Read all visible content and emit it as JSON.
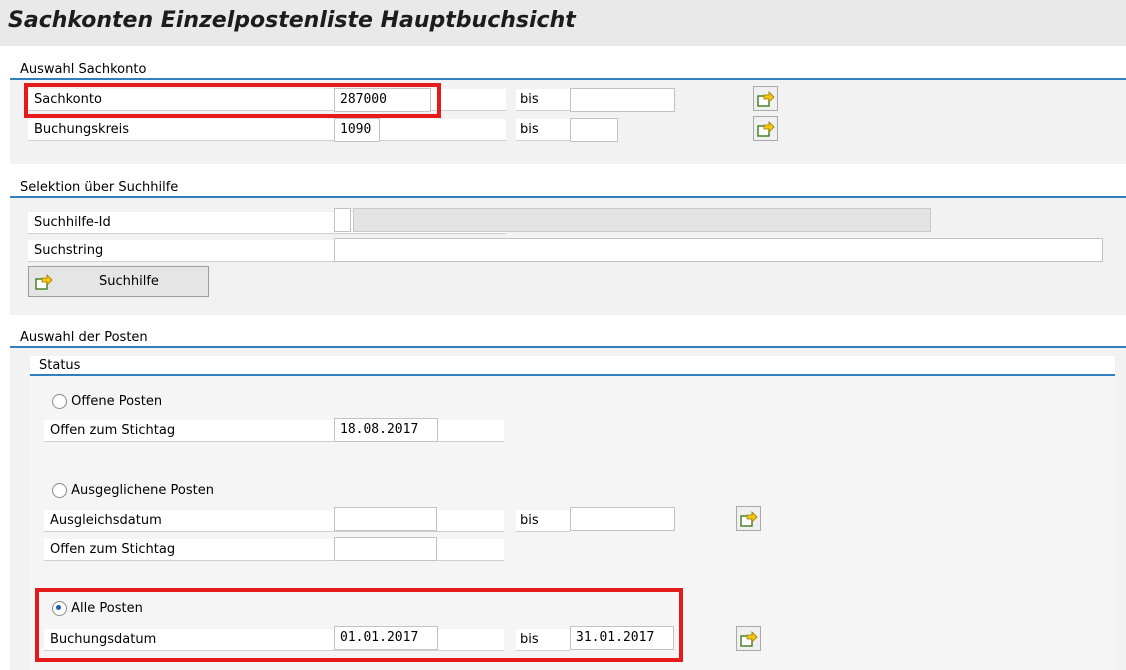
{
  "title": "Sachkonten Einzelpostenliste Hauptbuchsicht",
  "section_account": {
    "header": "Auswahl Sachkonto",
    "rows": [
      {
        "label": "Sachkonto",
        "value": "287000",
        "bis": "bis",
        "to_value": ""
      },
      {
        "label": "Buchungskreis",
        "value": "1090",
        "bis": "bis",
        "to_value": ""
      }
    ]
  },
  "section_search": {
    "header": "Selektion über Suchhilfe",
    "id_label": "Suchhilfe-Id",
    "id_value": "",
    "id_desc": "",
    "string_label": "Suchstring",
    "string_value": "",
    "button_label": "Suchhilfe"
  },
  "section_items": {
    "header": "Auswahl der Posten",
    "status_header": "Status",
    "open": {
      "radio_label": "Offene Posten",
      "selected": false,
      "date_label": "Offen zum Stichtag",
      "date_value": "18.08.2017"
    },
    "cleared": {
      "radio_label": "Ausgeglichene Posten",
      "selected": false,
      "clear_date_label": "Ausgleichsdatum",
      "clear_from": "",
      "bis": "bis",
      "clear_to": "",
      "open_date_label": "Offen zum Stichtag",
      "open_date_value": ""
    },
    "all": {
      "radio_label": "Alle Posten",
      "selected": true,
      "date_label": "Buchungsdatum",
      "from": "01.01.2017",
      "bis": "bis",
      "to": "31.01.2017"
    }
  },
  "colors": {
    "accent": "#2f7fc1",
    "highlight": "#e31b1b"
  },
  "icons": {
    "multiple_selection": "multiple-selection-icon"
  }
}
